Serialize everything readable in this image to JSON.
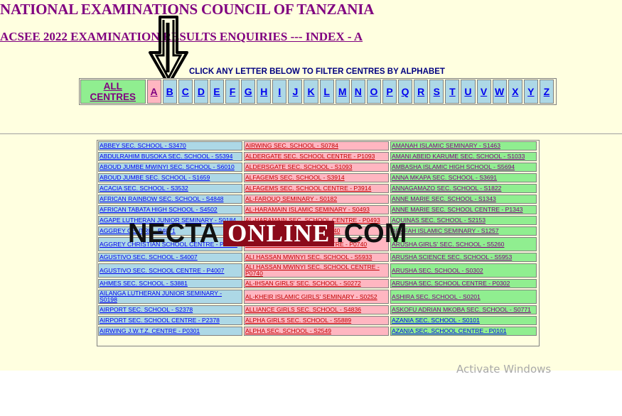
{
  "header": {
    "title": "NATIONAL EXAMINATIONS COUNCIL OF TANZANIA",
    "subtitle": "ACSEE 2022 EXAMINATION RESULTS ENQUIRIES --- INDEX - A",
    "instruction": "CLICK ANY LETTER BELOW TO FILTER CENTRES BY ALPHABET"
  },
  "filter": {
    "all_label_1": "ALL",
    "all_label_2": "CENTRES",
    "letters": [
      "A",
      "B",
      "C",
      "D",
      "E",
      "F",
      "G",
      "H",
      "I",
      "J",
      "K",
      "L",
      "M",
      "N",
      "O",
      "P",
      "Q",
      "R",
      "S",
      "T",
      "U",
      "V",
      "W",
      "X",
      "Y",
      "Z"
    ],
    "selected": "A"
  },
  "centres": {
    "col1": [
      "ABBEY SEC. SCHOOL - S3470",
      "ABDULRAHIM BUSOKA SEC. SCHOOL - S5394",
      "ABOUD JUMBE MWINYI SEC. SCHOOL - S6010",
      "ABOUD JUMBE SEC. SCHOOL - S1659",
      "ACACIA SEC. SCHOOL - S3532",
      "AFRICAN RAINBOW SEC. SCHOOL - S4848",
      "AFRICAN TABATA HIGH SCHOOL - S4502",
      "AGAPE LUTHERAN JUNIOR SEMINARY - S0184",
      "AGGREY CENTRE - P4071",
      "AGGREY CHRISTIAN SCHOOL CENTRE - P4071",
      "AGUSTIVO SEC. SCHOOL - S4007",
      "AGUSTIVO SEC. SCHOOL CENTRE - P4007",
      "AHMES SEC. SCHOOL - S3881",
      "AILANGA LUTHERAN JUNIOR SEMINARY - S0198",
      "AIRPORT SEC. SCHOOL - S2378",
      "AIRPORT SEC. SCHOOL CENTRE - P2378",
      "AIRWING J.W.T.Z. CENTRE - P0301"
    ],
    "col2": [
      "AIRWING SEC. SCHOOL - S0784",
      "ALDERGATE SEC. SCHOOL CENTRE - P1093",
      "ALDERSGATE SEC. SCHOOL - S1093",
      "ALFAGEMS SEC. SCHOOL - S3914",
      "ALFAGEMS SEC. SCHOOL CENTRE - P3914",
      "AL-FAROUQ SEMINARY - S0182",
      "AL-HARAMAIN ISLAMIC SEMINARY - S0493",
      "AL-HARAMAIN SEC. SCHOOL CENTRE - P0493",
      "AL-HIKMA SEC. SCHOOL - S0740",
      "AL-HIKMA SEC. SCHOOL CENTRE - P0740",
      "ALI HASSAN MWINYI SEC. SCHOOL - S5933",
      "ALI HASSAN MWINYI SEC. SCHOOL CENTRE - P0740",
      "AL-IHSAN GIRLS' SEC. SCHOOL - S0272",
      "AL-KHEIR ISLAMIC GIRLS' SEMINARY - S0252",
      "ALLIANCE GIRLS SEC. SCHOOL - S4836",
      "ALPHA GIRLS SEC. SCHOOL - S5889",
      "ALPHA SEC. SCHOOL - S2549"
    ],
    "col3": [
      "AMANAH ISLAMIC SEMINARY - S1463",
      "AMANI ABEID KARUME SEC. SCHOOL - S1033",
      "AMBASHA ISLAMIC HIGH SCHOOL - S5694",
      "ANNA MKAPA SEC. SCHOOL - S3691",
      "ANNAGAMAZO SEC. SCHOOL - S1822",
      "ANNE MARIE SEC. SCHOOL - S1343",
      "ANNE MARIE SEC. SCHOOL CENTRE - P1343",
      "AQUINAS SEC. SCHOOL - S2153",
      "ARAFAH ISLAMIC SEMINARY - S1257",
      "ARUSHA GIRLS' SEC. SCHOOL - S5260",
      "ARUSHA SCIENCE SEC. SCHOOL - S5953",
      "ARUSHA SEC. SCHOOL - S0302",
      "ARUSHA SEC. SCHOOL CENTRE - P0302",
      "ASHIRA SEC. SCHOOL - S0201",
      "ASKOFU ADRIAN MKOBA SEC. SCHOOL - S0771",
      "AZANIA SEC. SCHOOL - S0101",
      "AZANIA SEC. SCHOOL CENTRE - P0101"
    ]
  },
  "watermark": {
    "part1": "NECTA",
    "part2": "ONLINE",
    "part3": ".COM"
  },
  "os_notice": "Activate Windows",
  "colors": {
    "page_bg": "#ffffe0",
    "heading": "#800080",
    "col1_bg": "#add8e6",
    "col2_bg": "#ffb6c1",
    "col3_bg": "#90ee90",
    "watermark_box": "#8b0a1a"
  }
}
